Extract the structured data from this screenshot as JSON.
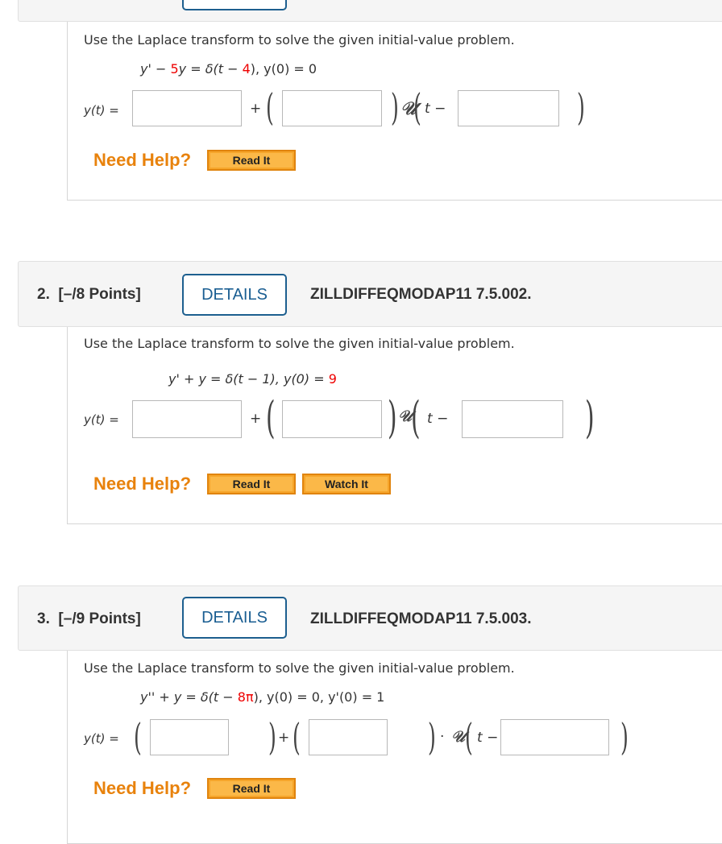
{
  "problem1_partial": {
    "prompt": "Use the Laplace transform to solve the given initial-value problem.",
    "equation": {
      "lhs_a": "y' − ",
      "coef": "5",
      "lhs_b": "y = δ(t − ",
      "shift": "4",
      "rhs": "),  y(0) = 0"
    },
    "answer_label": "y(t) =",
    "plus": "+",
    "u_symbol": "𝒰",
    "t_minus": "t −",
    "inputs": [
      "",
      "",
      ""
    ],
    "need_help": "Need Help?",
    "buttons": [
      "Read It"
    ]
  },
  "problem2": {
    "number": "2.",
    "points": "[–/8 Points]",
    "details_label": "DETAILS",
    "code": "ZILLDIFFEQMODAP11 7.5.002.",
    "prompt": "Use the Laplace transform to solve the given initial-value problem.",
    "equation": {
      "lhs": "y' + y = δ(t − 1),  y(0) = ",
      "ic": "9"
    },
    "answer_label": "y(t) =",
    "plus": "+",
    "u_symbol": "𝒰",
    "t_minus": "t −",
    "inputs": [
      "",
      "",
      ""
    ],
    "need_help": "Need Help?",
    "buttons": [
      "Read It",
      "Watch It"
    ]
  },
  "problem3": {
    "number": "3.",
    "points": "[–/9 Points]",
    "details_label": "DETAILS",
    "code": "ZILLDIFFEQMODAP11 7.5.003.",
    "prompt": "Use the Laplace transform to solve the given initial-value problem.",
    "equation": {
      "lhs": "y'' + y = δ(t − ",
      "shift": "8π",
      "rhs": "),    y(0) = 0,  y'(0) = 1"
    },
    "answer_label": "y(t) =",
    "plus": "+",
    "dot": "·",
    "u_symbol": "𝒰",
    "t_minus": "t −",
    "inputs": [
      "",
      "",
      ""
    ],
    "need_help": "Need Help?",
    "buttons": [
      "Read It"
    ]
  }
}
